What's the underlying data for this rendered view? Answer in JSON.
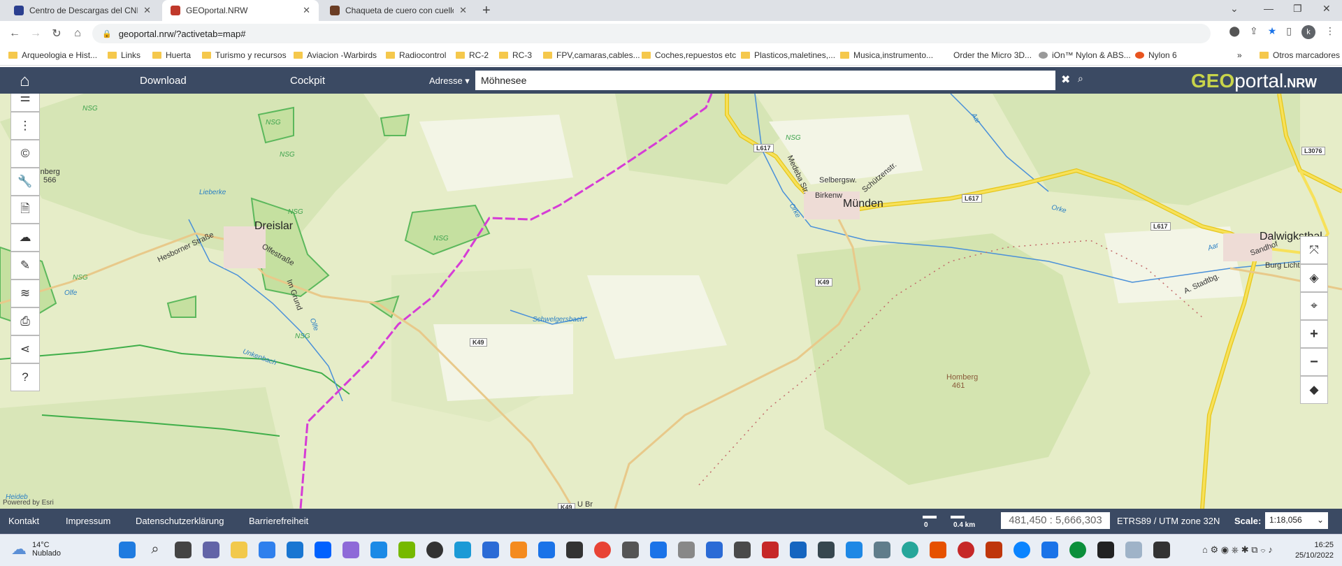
{
  "browser": {
    "tabs": [
      {
        "title": "Centro de Descargas del CNIG (I",
        "active": false,
        "favicon_color": "#2b3f8f"
      },
      {
        "title": "GEOportal.NRW",
        "active": true,
        "favicon_color": "#c0392b"
      },
      {
        "title": "Chaqueta de cuero con cuello alt",
        "active": false,
        "favicon_color": "#6b3d24"
      }
    ],
    "url": "geoportal.nrw/?activetab=map#",
    "profile_initial": "k",
    "bookmarks": [
      "Arqueologia e Hist...",
      "Links",
      "Huerta",
      "Turismo y recursos",
      "Aviacion -Warbirds",
      "Radiocontrol",
      "RC-2",
      "RC-3",
      "FPV,camaras,cables...",
      "Coches,repuestos etc",
      "Plasticos,maletines,...",
      "Musica,instrumento...",
      "Order the Micro 3D...",
      "iOn™ Nylon & ABS...",
      "Nylon 6",
      "»",
      "Otros marcadores"
    ]
  },
  "app": {
    "nav": {
      "download": "Download",
      "cockpit": "Cockpit",
      "adresse": "Adresse ▾"
    },
    "search": {
      "value": "Möhnesee"
    },
    "logo": {
      "geo": "GEO",
      "portal": "portal",
      "nrw": ".NRW"
    }
  },
  "map": {
    "labels": {
      "dreislar": "Dreislar",
      "munden": "Münden",
      "dalwigksthal": "Dalwigksthal",
      "hesborner": "Hesborner Straße",
      "olfestr": "Olfestraße",
      "imgrund": "Im Grund",
      "olfe": "Olfe",
      "olfe2": "Olfe",
      "unkenbach": "Unkenbach",
      "lieberke": "Lieberke",
      "schwelgersbach": "Schwelgersbach",
      "senberg": "senberg",
      "senberg_h": "566",
      "homberg": "Homberg",
      "homberg_h": "461",
      "medebach": "Medeba Str.",
      "selbergsw": "Selbergsw.",
      "schutzenstr": "Schützenstr.",
      "birkenw": "Birkenw",
      "orke": "Orke",
      "orke2": "Orke",
      "aar": "Aar",
      "aar2": "Aar",
      "sandhof": "Sandhof",
      "burglicht": "Burg Licht",
      "astadtbg": "A. Stadtbg.",
      "heideb": "Heideb",
      "ubr": "U Br"
    },
    "roads": {
      "l617a": "L617",
      "l617b": "L617",
      "l617c": "L617",
      "l3076": "L3076",
      "k49a": "K49",
      "k49b": "K49",
      "k49c": "K49"
    },
    "nsg": [
      "NSG",
      "NSG",
      "NSG",
      "NSG",
      "NSG",
      "NSG",
      "NSG",
      "NSG"
    ],
    "powered": "Powered by Esri"
  },
  "footer": {
    "links": [
      "Kontakt",
      "Impressum",
      "Datenschutzerklärung",
      "Barrierefreiheit"
    ],
    "scalebar": {
      "zero": "0",
      "dist": "0.4 km"
    },
    "coords": "481,450 : 5,666,303",
    "crs": "ETRS89 / UTM zone 32N",
    "scale_label": "Scale:",
    "scale_value": "1:18,056"
  },
  "taskbar": {
    "weather_temp": "14°C",
    "weather_desc": "Nublado",
    "time": "16:25",
    "date": "25/10/2022"
  }
}
